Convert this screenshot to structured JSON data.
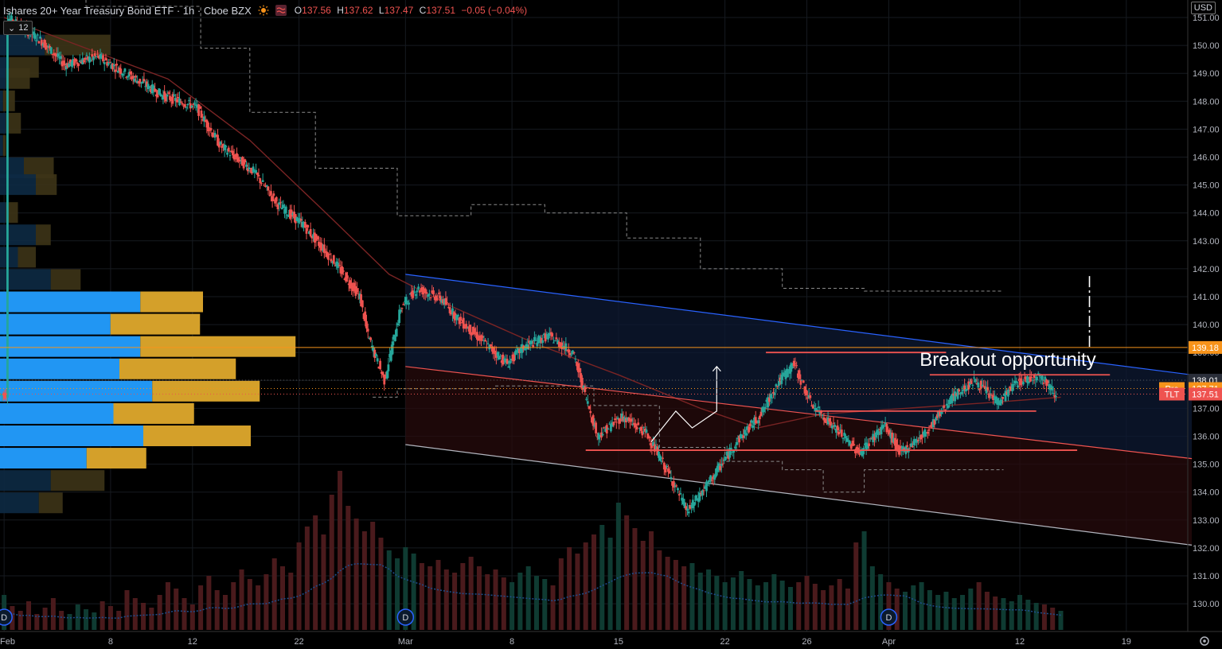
{
  "header": {
    "title": "Ishares 20+ Year Treasury Bond ETF · 1h · Cboe BZX",
    "o_label": "O",
    "o": "137.56",
    "h_label": "H",
    "h": "137.62",
    "l_label": "L",
    "l": "137.47",
    "c_label": "C",
    "c": "137.51",
    "change": "−0.05 (−0.04%)",
    "indicator_icons": [
      "sun-icon",
      "wave-icon"
    ]
  },
  "volume_profile_control": {
    "chevron": "⌄",
    "value": "12"
  },
  "currency": "USD",
  "annotation": {
    "text": "Breakout opportunity"
  },
  "price_tags": [
    {
      "label": "",
      "value": "139.18",
      "color": "#f7931a"
    },
    {
      "label": "",
      "value": "138.01",
      "color": "#2a2e39"
    },
    {
      "label": "Pre",
      "value": "137.71",
      "color": "#f7931a"
    },
    {
      "label": "TLT",
      "value": "137.51",
      "color": "#ef5350"
    }
  ],
  "colors": {
    "up": "#26a69a",
    "down": "#ef5350",
    "channel_upper": "#2962ff",
    "channel_mid": "#ef5350",
    "channel_lower": "#b2b5be",
    "ma": "#ef5350",
    "level_orange": "#f7931a",
    "vp_blue": "#2196f3",
    "vp_gold": "#d4a02a"
  },
  "chart_data": {
    "type": "candlestick",
    "ylim": [
      129.6,
      151.2
    ],
    "y_ticks": [
      130,
      131,
      132,
      133,
      134,
      135,
      136,
      137,
      138,
      139,
      140,
      141,
      142,
      143,
      144,
      145,
      146,
      147,
      148,
      149,
      150,
      151
    ],
    "x_ticks": [
      "Feb",
      "8",
      "12",
      "22",
      "Mar",
      "8",
      "15",
      "22",
      "26",
      "Apr",
      "12",
      "19"
    ],
    "event_markers": [
      "D",
      "D",
      "D"
    ],
    "path_points": [
      [
        1,
        151.0
      ],
      [
        5,
        150.2
      ],
      [
        8,
        149.3
      ],
      [
        12,
        149.6
      ],
      [
        16,
        148.9
      ],
      [
        20,
        148.2
      ],
      [
        24,
        147.8
      ],
      [
        27,
        146.4
      ],
      [
        31,
        145.5
      ],
      [
        34,
        144.3
      ],
      [
        37,
        143.6
      ],
      [
        41,
        142.2
      ],
      [
        44,
        141.0
      ],
      [
        45,
        139.6
      ],
      [
        47,
        138.0
      ],
      [
        49,
        140.6
      ],
      [
        51,
        141.3
      ],
      [
        54,
        140.9
      ],
      [
        56,
        140.2
      ],
      [
        59,
        139.4
      ],
      [
        62,
        138.6
      ],
      [
        64,
        139.2
      ],
      [
        67,
        139.6
      ],
      [
        70,
        139.0
      ],
      [
        73,
        136.0
      ],
      [
        76,
        136.7
      ],
      [
        79,
        136.1
      ],
      [
        82,
        134.5
      ],
      [
        84,
        133.3
      ],
      [
        87,
        134.5
      ],
      [
        90,
        135.8
      ],
      [
        93,
        136.8
      ],
      [
        95,
        137.9
      ],
      [
        97,
        138.6
      ],
      [
        99,
        137.2
      ],
      [
        102,
        136.3
      ],
      [
        105,
        135.4
      ],
      [
        108,
        136.4
      ],
      [
        110,
        135.4
      ],
      [
        113,
        136.1
      ],
      [
        116,
        137.3
      ],
      [
        119,
        138.0
      ],
      [
        122,
        137.2
      ],
      [
        124,
        137.9
      ],
      [
        127,
        138.2
      ],
      [
        129,
        137.5
      ]
    ],
    "moving_average": [
      [
        0,
        151.0
      ],
      [
        10,
        149.9
      ],
      [
        20,
        148.8
      ],
      [
        30,
        146.6
      ],
      [
        40,
        143.8
      ],
      [
        47,
        141.8
      ],
      [
        55,
        140.6
      ],
      [
        65,
        139.3
      ],
      [
        75,
        138.2
      ],
      [
        85,
        137.0
      ],
      [
        92,
        136.3
      ],
      [
        100,
        136.8
      ],
      [
        110,
        137.0
      ],
      [
        120,
        137.2
      ],
      [
        129,
        137.4
      ]
    ],
    "value_area_high": [
      [
        0,
        151.9
      ],
      [
        10,
        151.4
      ],
      [
        24,
        149.9
      ],
      [
        30,
        147.6
      ],
      [
        38,
        145.6
      ],
      [
        48,
        143.9
      ],
      [
        57,
        144.3
      ],
      [
        66,
        144.0
      ],
      [
        76,
        143.1
      ],
      [
        85,
        142.0
      ],
      [
        95,
        141.3
      ],
      [
        105,
        141.2
      ],
      [
        122,
        141.2
      ]
    ],
    "value_area_low": [
      [
        45,
        137.4
      ],
      [
        48,
        137.7
      ],
      [
        60,
        137.8
      ],
      [
        72,
        137.1
      ],
      [
        80,
        135.6
      ],
      [
        88,
        135.1
      ],
      [
        95,
        134.8
      ],
      [
        100,
        134.0
      ],
      [
        105,
        134.8
      ],
      [
        122,
        134.8
      ]
    ],
    "channel": {
      "upper": [
        [
          49,
          141.8
        ],
        [
          145,
          138.2
        ]
      ],
      "mid": [
        [
          49,
          138.5
        ],
        [
          145,
          135.2
        ]
      ],
      "lower": [
        [
          49,
          135.7
        ],
        [
          145,
          132.1
        ]
      ]
    },
    "support_resistance_lines": [
      {
        "x": [
          93,
          115
        ],
        "y": 139.0
      },
      {
        "x": [
          113,
          135
        ],
        "y": 138.2
      },
      {
        "x": [
          99,
          126
        ],
        "y": 136.9
      },
      {
        "x": [
          71,
          131
        ],
        "y": 135.5
      }
    ],
    "horizontal_levels": [
      139.18,
      138.01,
      137.71,
      137.51
    ],
    "projection": {
      "x": 132.5,
      "y": [
        139.2,
        141.8
      ]
    },
    "zigzag": [
      [
        79,
        135.8
      ],
      [
        82,
        136.9
      ],
      [
        84,
        136.3
      ],
      [
        87,
        136.9
      ],
      [
        87,
        138.5
      ]
    ],
    "volume_profile": [
      {
        "price": 150.0,
        "up": 0.15,
        "down": 0.22
      },
      {
        "price": 149.2,
        "up": 0.03,
        "down": 0.1
      },
      {
        "price": 148.8,
        "up": 0.02,
        "down": 0.08
      },
      {
        "price": 148.0,
        "up": 0.01,
        "down": 0.04
      },
      {
        "price": 147.2,
        "up": 0.02,
        "down": 0.05
      },
      {
        "price": 146.4,
        "up": 0.01,
        "down": 0.01
      },
      {
        "price": 145.6,
        "up": 0.08,
        "down": 0.1
      },
      {
        "price": 145.0,
        "up": 0.12,
        "down": 0.07
      },
      {
        "price": 144.0,
        "up": 0.02,
        "down": 0.04
      },
      {
        "price": 143.2,
        "up": 0.12,
        "down": 0.05
      },
      {
        "price": 142.4,
        "up": 0.06,
        "down": 0.06
      },
      {
        "price": 141.6,
        "up": 0.17,
        "down": 0.1
      },
      {
        "price": 140.8,
        "up": 0.47,
        "down": 0.21
      },
      {
        "price": 140.0,
        "up": 0.37,
        "down": 0.3
      },
      {
        "price": 139.2,
        "up": 0.47,
        "down": 0.52
      },
      {
        "price": 138.4,
        "up": 0.4,
        "down": 0.39
      },
      {
        "price": 137.6,
        "up": 0.51,
        "down": 0.36
      },
      {
        "price": 136.8,
        "up": 0.38,
        "down": 0.27
      },
      {
        "price": 136.0,
        "up": 0.48,
        "down": 0.36
      },
      {
        "price": 135.2,
        "up": 0.29,
        "down": 0.2
      },
      {
        "price": 134.4,
        "up": 0.17,
        "down": 0.18
      },
      {
        "price": 133.6,
        "up": 0.13,
        "down": 0.08
      }
    ],
    "volume_relative": [
      0.22,
      0.15,
      0.12,
      0.18,
      0.1,
      0.14,
      0.2,
      0.12,
      0.1,
      0.16,
      0.13,
      0.11,
      0.18,
      0.15,
      0.12,
      0.25,
      0.2,
      0.17,
      0.14,
      0.22,
      0.3,
      0.26,
      0.2,
      0.16,
      0.28,
      0.34,
      0.25,
      0.22,
      0.3,
      0.38,
      0.32,
      0.28,
      0.35,
      0.45,
      0.4,
      0.36,
      0.55,
      0.65,
      0.72,
      0.6,
      0.85,
      1.0,
      0.78,
      0.7,
      0.62,
      0.68,
      0.58,
      0.5,
      0.45,
      0.52,
      0.48,
      0.42,
      0.4,
      0.44,
      0.38,
      0.36,
      0.42,
      0.46,
      0.4,
      0.35,
      0.38,
      0.33,
      0.3,
      0.36,
      0.4,
      0.34,
      0.32,
      0.28,
      0.45,
      0.52,
      0.48,
      0.55,
      0.6,
      0.66,
      0.58,
      0.8,
      0.72,
      0.64,
      0.56,
      0.62,
      0.5,
      0.46,
      0.44,
      0.4,
      0.42,
      0.36,
      0.38,
      0.34,
      0.3,
      0.33,
      0.37,
      0.32,
      0.28,
      0.3,
      0.35,
      0.31,
      0.27,
      0.3,
      0.34,
      0.29,
      0.25,
      0.28,
      0.32,
      0.26,
      0.55,
      0.62,
      0.4,
      0.35,
      0.3,
      0.26,
      0.24,
      0.28,
      0.3,
      0.25,
      0.22,
      0.24,
      0.2,
      0.22,
      0.26,
      0.3,
      0.24,
      0.21,
      0.2,
      0.18,
      0.22,
      0.19,
      0.17,
      0.16,
      0.14,
      0.12
    ]
  }
}
